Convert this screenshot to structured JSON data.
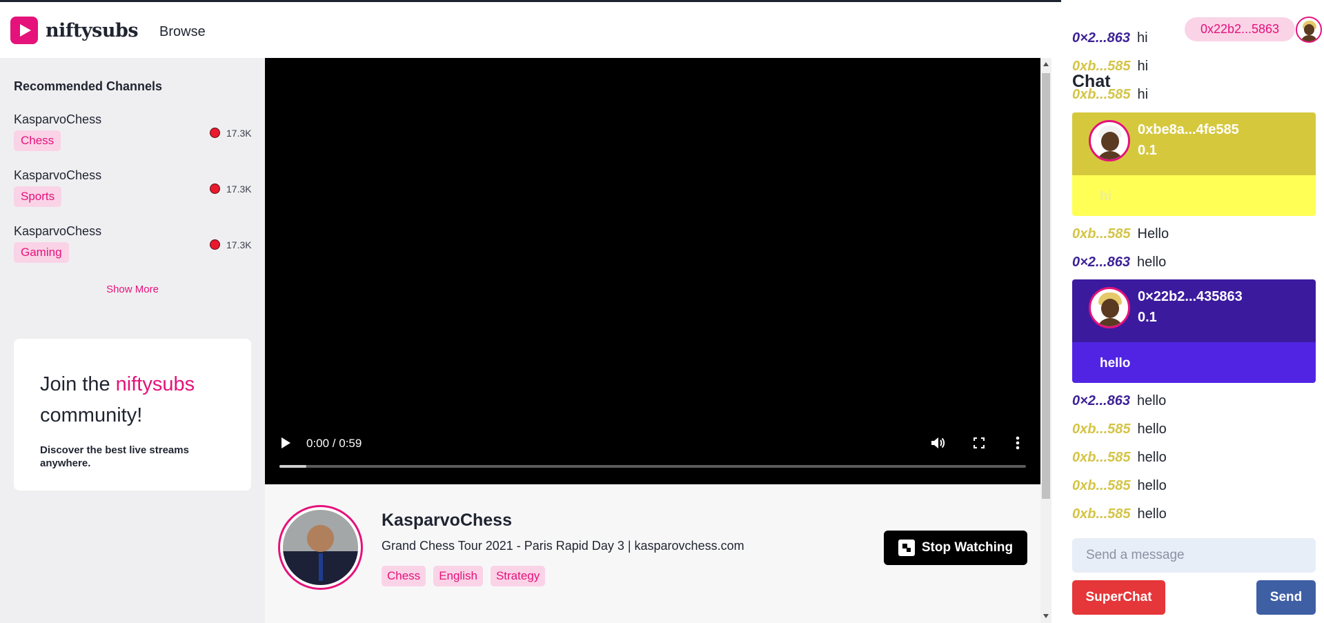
{
  "header": {
    "brand": "niftysubs",
    "nav_browse": "Browse"
  },
  "sidebar": {
    "title": "Recommended Channels",
    "channels": [
      {
        "name": "KasparvoChess",
        "tag": "Chess",
        "viewers": "17.3K"
      },
      {
        "name": "KasparvoChess",
        "tag": "Sports",
        "viewers": "17.3K"
      },
      {
        "name": "KasparvoChess",
        "tag": "Gaming",
        "viewers": "17.3K"
      }
    ],
    "show_more": "Show More",
    "join": {
      "prefix": "Join the ",
      "brand": "niftysubs",
      "suffix": "community!",
      "description": "Discover the best live streams anywhere."
    }
  },
  "video": {
    "time": "0:00 / 0:59",
    "progress_fraction": 0.036
  },
  "stream": {
    "streamer_name": "KasparvoChess",
    "title": "Grand Chess Tour 2021 - Paris Rapid Day 3 | kasparovchess.com",
    "tags": [
      "Chess",
      "English",
      "Strategy"
    ],
    "stop_button": "Stop Watching"
  },
  "chat": {
    "heading": "Chat",
    "user_address": "0x22b2...5863",
    "messages": [
      {
        "addr": "0×2...863",
        "text": "hi",
        "color": "purple"
      },
      {
        "addr": "0xb...585",
        "text": "hi",
        "color": "yellow"
      },
      {
        "addr": "0xb...585",
        "text": "hi",
        "color": "yellow"
      }
    ],
    "superchat_1": {
      "name": "0xbe8a...4fe585",
      "amount": "0.1",
      "text": "hi",
      "head_color": "#d6c83d",
      "body_color": "#ffff55"
    },
    "messages_2": [
      {
        "addr": "0xb...585",
        "text": "Hello",
        "color": "yellow"
      },
      {
        "addr": "0×2...863",
        "text": "hello",
        "color": "purple"
      }
    ],
    "superchat_2": {
      "name": "0×22b2...435863",
      "amount": "0.1",
      "text": "hello",
      "head_color": "#3b1a9e",
      "body_color": "#5124e3"
    },
    "messages_3": [
      {
        "addr": "0×2...863",
        "text": "hello",
        "color": "purple"
      },
      {
        "addr": "0xb...585",
        "text": "hello",
        "color": "yellow"
      },
      {
        "addr": "0xb...585",
        "text": "hello",
        "color": "yellow"
      },
      {
        "addr": "0xb...585",
        "text": "hello",
        "color": "yellow"
      },
      {
        "addr": "0xb...585",
        "text": "hello",
        "color": "yellow"
      }
    ],
    "input_placeholder": "Send a message",
    "superchat_button": "SuperChat",
    "send_button": "Send"
  },
  "colors": {
    "accent": "#e4127a",
    "yellow_addr": "#d4c445",
    "purple_addr": "#3d2296"
  }
}
